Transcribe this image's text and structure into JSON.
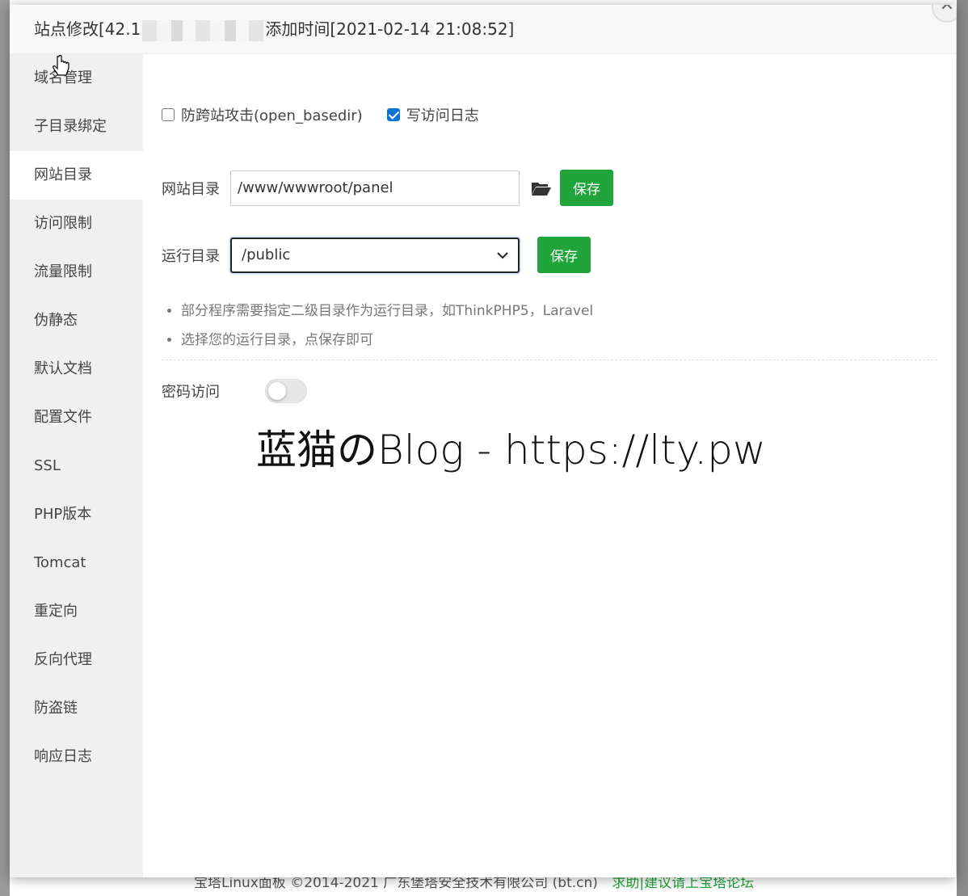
{
  "title": {
    "prefix": "站点修改[42.1",
    "suffix": "添加时间[2021-02-14 21:08:52]"
  },
  "close_symbol": "✕",
  "sidebar": {
    "items": [
      {
        "label": "域名管理"
      },
      {
        "label": "子目录绑定"
      },
      {
        "label": "网站目录",
        "active": true
      },
      {
        "label": "访问限制"
      },
      {
        "label": "流量限制"
      },
      {
        "label": "伪静态"
      },
      {
        "label": "默认文档"
      },
      {
        "label": "配置文件"
      },
      {
        "label": "SSL"
      },
      {
        "label": "PHP版本"
      },
      {
        "label": "Tomcat"
      },
      {
        "label": "重定向"
      },
      {
        "label": "反向代理"
      },
      {
        "label": "防盗链"
      },
      {
        "label": "响应日志"
      }
    ]
  },
  "options": {
    "open_basedir": {
      "label": "防跨站攻击(open_basedir)",
      "checked": false
    },
    "access_log": {
      "label": "写访问日志",
      "checked": true
    }
  },
  "site_dir": {
    "label": "网站目录",
    "value": "/www/wwwroot/panel",
    "save_label": "保存"
  },
  "run_dir": {
    "label": "运行目录",
    "selected": "/public",
    "save_label": "保存"
  },
  "tips": [
    "部分程序需要指定二级目录作为运行目录，如ThinkPHP5，Laravel",
    "选择您的运行目录，点保存即可"
  ],
  "password_access": {
    "label": "密码访问",
    "enabled": false
  },
  "watermark": "蓝猫のBlog - https://lty.pw",
  "footer": {
    "copyright": "宝塔Linux面板 ©2014-2021 广东堡塔安全技术有限公司 (bt.cn)",
    "link": "求助|建议请上宝塔论坛"
  },
  "colors": {
    "accent": "#20a53a",
    "checkbox": "#0b74d8"
  }
}
